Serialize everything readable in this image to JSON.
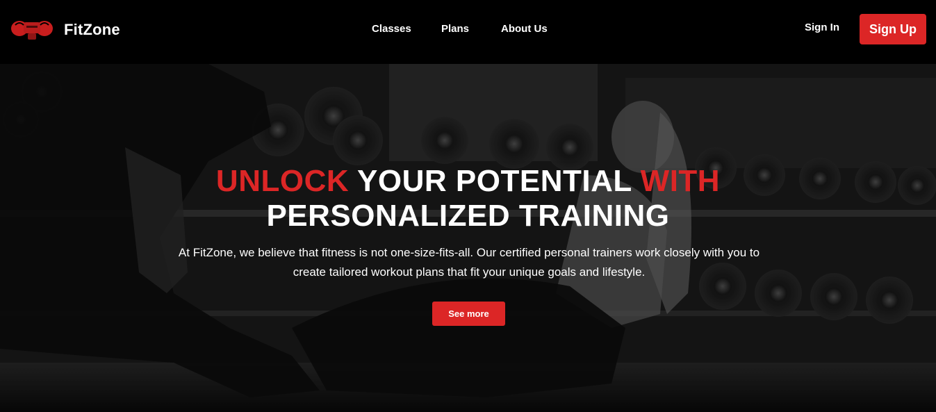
{
  "header": {
    "brand": "FitZone",
    "logo_icon": "boxing-gloves-icon",
    "nav": [
      {
        "label": "Classes"
      },
      {
        "label": "Plans"
      },
      {
        "label": "About Us"
      }
    ],
    "sign_in": "Sign In",
    "sign_up": "Sign Up"
  },
  "hero": {
    "headline": {
      "part1": "UNLOCK",
      "part2": " YOUR POTENTIAL ",
      "part3": "WITH",
      "line2": "PERSONALIZED TRAINING"
    },
    "description": "At FitZone, we believe that fitness is not one-size-fits-all. Our certified personal trainers work closely with you to create tailored workout plans that fit your unique goals and lifestyle.",
    "cta": "See more",
    "background": "black-and-white gym photo"
  },
  "colors": {
    "accent": "#dc2626",
    "header_bg": "#000000",
    "text": "#ffffff"
  }
}
